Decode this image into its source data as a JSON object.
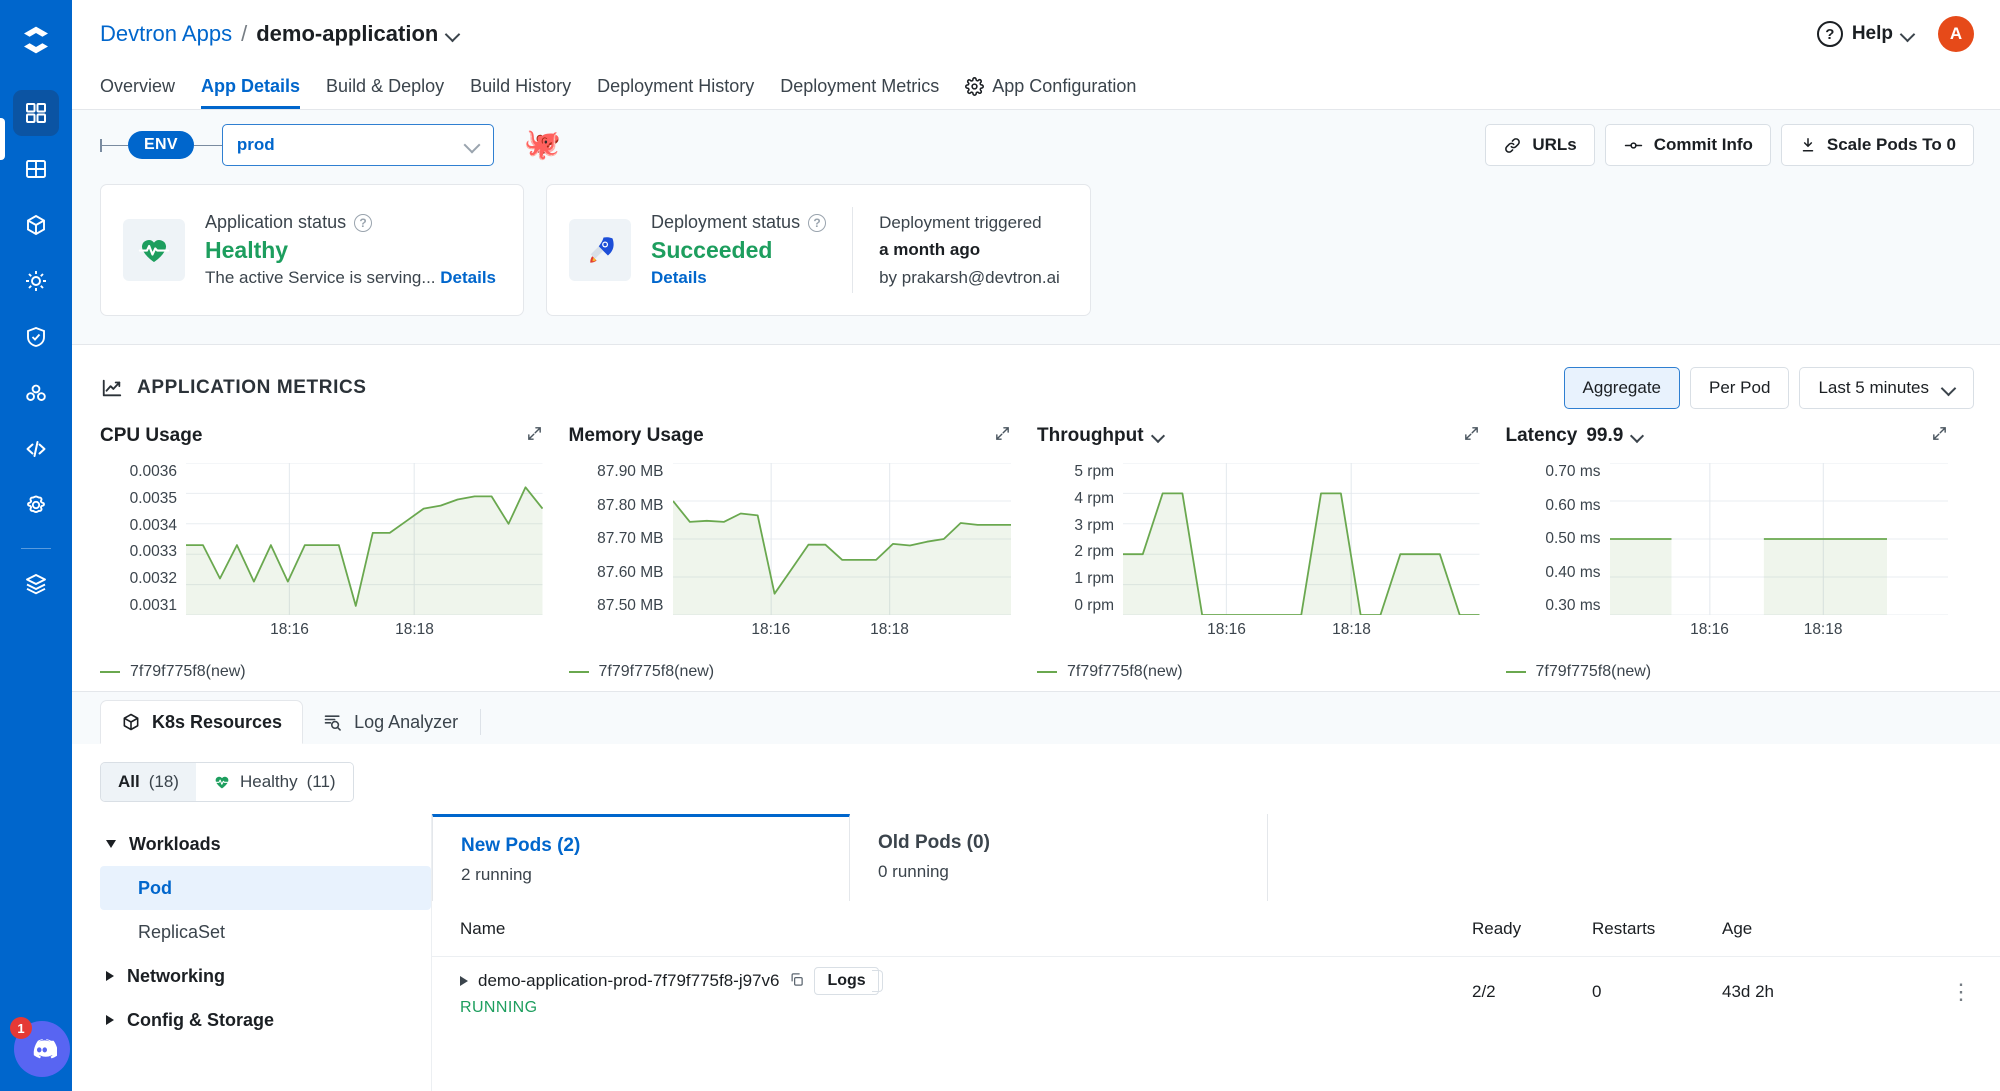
{
  "rail": {
    "logo": "devtron-logo",
    "items": [
      {
        "name": "apps-grid-icon",
        "active": true
      },
      {
        "name": "chart-store-icon",
        "active": false
      },
      {
        "name": "cube-package-icon",
        "active": false
      },
      {
        "name": "helm-wheel-icon",
        "active": false
      },
      {
        "name": "shield-check-icon",
        "active": false
      },
      {
        "name": "clusters-hex-icon",
        "active": false
      },
      {
        "name": "code-brackets-icon",
        "active": false
      },
      {
        "name": "gear-cloud-icon",
        "active": false
      },
      {
        "name": "stack-layers-icon",
        "active": false
      }
    ],
    "discord_badge": "1"
  },
  "header": {
    "breadcrumb_root": "Devtron Apps",
    "breadcrumb_sep": "/",
    "breadcrumb_current": "demo-application",
    "help_label": "Help",
    "avatar_initial": "A"
  },
  "nav_tabs": [
    {
      "label": "Overview",
      "selected": false,
      "icon": ""
    },
    {
      "label": "App Details",
      "selected": true,
      "icon": ""
    },
    {
      "label": "Build & Deploy",
      "selected": false,
      "icon": ""
    },
    {
      "label": "Build History",
      "selected": false,
      "icon": ""
    },
    {
      "label": "Deployment History",
      "selected": false,
      "icon": ""
    },
    {
      "label": "Deployment Metrics",
      "selected": false,
      "icon": ""
    },
    {
      "label": "App Configuration",
      "selected": false,
      "icon": "gear-icon"
    }
  ],
  "env_bar": {
    "env_pill": "ENV",
    "env_value": "prod",
    "mascot": "octopus-mascot",
    "actions": [
      {
        "label": "URLs",
        "icon": "link-icon"
      },
      {
        "label": "Commit Info",
        "icon": "commit-icon"
      },
      {
        "label": "Scale Pods To 0",
        "icon": "scale-down-icon"
      }
    ]
  },
  "status_cards": {
    "app": {
      "title": "Application status",
      "value": "Healthy",
      "desc": "The active Service is serving...",
      "details_label": "Details",
      "icon": "heartbeat-icon",
      "value_color": "#1d9e5e"
    },
    "deployment": {
      "title": "Deployment status",
      "value": "Succeeded",
      "details_label": "Details",
      "icon": "rocket-icon",
      "value_color": "#1d9e5e",
      "trigger_label": "Deployment triggered",
      "trigger_time": "a month ago",
      "trigger_by": "by prakarsh@devtron.ai"
    }
  },
  "metrics": {
    "title": "APPLICATION METRICS",
    "title_icon": "trend-up-icon",
    "aggregate_label": "Aggregate",
    "per_pod_label": "Per Pod",
    "range_label": "Last 5 minutes"
  },
  "chart_data": [
    {
      "type": "area",
      "title": "CPU Usage",
      "has_dropdown": false,
      "expand_icon": "expand-icon",
      "legend": [
        "7f79f775f8(new)"
      ],
      "legend_position": "bottom-left",
      "grid": true,
      "xlabel": "",
      "ylabel": "",
      "ytick_labels": [
        "0.0036",
        "0.0035",
        "0.0034",
        "0.0033",
        "0.0032",
        "0.0031"
      ],
      "ylim": [
        0.0031,
        0.0036
      ],
      "xtick_labels": [
        "18:16",
        "18:18"
      ],
      "xtick_positions": [
        0.29,
        0.64
      ],
      "series": [
        {
          "name": "7f79f775f8(new)",
          "color": "#6aa84f",
          "values": [
            0.00333,
            0.00333,
            0.00322,
            0.00333,
            0.00321,
            0.00333,
            0.00321,
            0.00333,
            0.00333,
            0.00333,
            0.00313,
            0.00337,
            0.00337,
            0.00341,
            0.00345,
            0.00346,
            0.00348,
            0.00349,
            0.00349,
            0.0034,
            0.00352,
            0.00345
          ]
        }
      ]
    },
    {
      "type": "area",
      "title": "Memory Usage",
      "has_dropdown": false,
      "expand_icon": "expand-icon",
      "legend": [
        "7f79f775f8(new)"
      ],
      "legend_position": "bottom-left",
      "grid": true,
      "xlabel": "",
      "ylabel": "",
      "ytick_labels": [
        "87.90 MB",
        "87.80 MB",
        "87.70 MB",
        "87.60 MB",
        "87.50 MB"
      ],
      "ylim": [
        87.5,
        87.9
      ],
      "xtick_labels": [
        "18:16",
        "18:18"
      ],
      "xtick_positions": [
        0.29,
        0.64
      ],
      "series": [
        {
          "name": "7f79f775f8(new)",
          "color": "#6aa84f",
          "values": [
            87.8,
            87.745,
            87.748,
            87.745,
            87.767,
            87.762,
            87.556,
            87.62,
            87.685,
            87.685,
            87.645,
            87.645,
            87.645,
            87.687,
            87.683,
            87.693,
            87.7,
            87.742,
            87.737,
            87.737,
            87.737
          ]
        }
      ]
    },
    {
      "type": "area",
      "title": "Throughput",
      "has_dropdown": true,
      "expand_icon": "expand-icon",
      "legend": [
        "7f79f775f8(new)"
      ],
      "legend_position": "bottom-left",
      "grid": true,
      "xlabel": "",
      "ylabel": "",
      "ytick_labels": [
        "5 rpm",
        "4 rpm",
        "3 rpm",
        "2 rpm",
        "1 rpm",
        "0 rpm"
      ],
      "ylim": [
        0,
        5
      ],
      "xtick_labels": [
        "18:16",
        "18:18"
      ],
      "xtick_positions": [
        0.29,
        0.64
      ],
      "series": [
        {
          "name": "7f79f775f8(new)",
          "color": "#6aa84f",
          "values": [
            2,
            2,
            4,
            4,
            0,
            0,
            0,
            0,
            0,
            0,
            4,
            4,
            0,
            0,
            2,
            2,
            2,
            0,
            0
          ]
        }
      ]
    },
    {
      "type": "area",
      "title": "Latency",
      "title_suffix": "99.9",
      "has_dropdown": true,
      "expand_icon": "expand-icon",
      "legend": [
        "7f79f775f8(new)"
      ],
      "legend_position": "bottom-left",
      "grid": true,
      "xlabel": "",
      "ylabel": "",
      "ytick_labels": [
        "0.70 ms",
        "0.60 ms",
        "0.50 ms",
        "0.40 ms",
        "0.30 ms"
      ],
      "ylim": [
        0.3,
        0.7
      ],
      "xtick_labels": [
        "18:16",
        "18:18"
      ],
      "xtick_positions": [
        0.295,
        0.63
      ],
      "series": [
        {
          "name": "7f79f775f8(new)",
          "color": "#6aa84f",
          "values": [
            0.5,
            0.5,
            0.5,
            null,
            null,
            0.5,
            0.5,
            0.5,
            0.5,
            0.5,
            null,
            null
          ]
        }
      ]
    }
  ],
  "lower_tabs": [
    {
      "label": "K8s Resources",
      "icon": "cube-icon",
      "selected": true
    },
    {
      "label": "Log Analyzer",
      "icon": "log-search-icon",
      "selected": false
    }
  ],
  "filters": [
    {
      "label": "All",
      "count": "(18)",
      "selected": true,
      "icon": ""
    },
    {
      "label": "Healthy",
      "count": "(11)",
      "selected": false,
      "icon": "heart-icon"
    }
  ],
  "tree": [
    {
      "label": "Workloads",
      "type": "group",
      "expanded": true
    },
    {
      "label": "Pod",
      "type": "leaf",
      "selected": true
    },
    {
      "label": "ReplicaSet",
      "type": "leaf",
      "selected": false
    },
    {
      "label": "Networking",
      "type": "group",
      "expanded": false
    },
    {
      "label": "Config & Storage",
      "type": "group",
      "expanded": false
    }
  ],
  "pod_tabs": [
    {
      "title": "New Pods (2)",
      "sub": "2 running",
      "selected": true
    },
    {
      "title": "Old Pods (0)",
      "sub": "0 running",
      "selected": false
    }
  ],
  "pod_table": {
    "columns": [
      "Name",
      "Ready",
      "Restarts",
      "Age"
    ],
    "rows": [
      {
        "name": "demo-application-prod-7f79f775f8-j97v6",
        "logs_label": "Logs",
        "status": "RUNNING",
        "ready": "2/2",
        "restarts": "0",
        "age": "43d 2h",
        "menu": "⋮"
      }
    ]
  },
  "colors": {
    "brand_blue": "#0066cc",
    "green": "#1d9e5e",
    "chart_green": "#6aa84f",
    "bg_grey": "#f7fafc"
  }
}
